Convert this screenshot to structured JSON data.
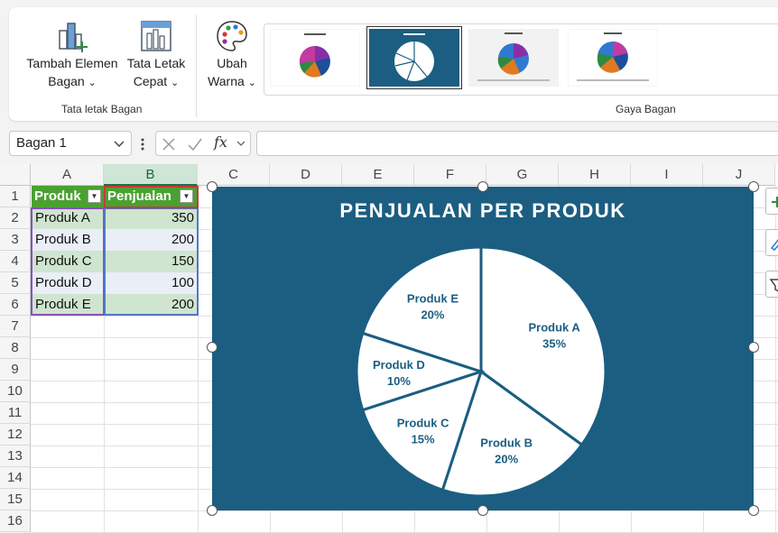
{
  "ribbon": {
    "add_element": {
      "line1": "Tambah Elemen",
      "line2": "Bagan"
    },
    "quick_layout": {
      "line1": "Tata Letak",
      "line2": "Cepat"
    },
    "change_colors": {
      "line1": "Ubah",
      "line2": "Warna"
    },
    "group_layout_label": "Tata letak Bagan",
    "group_styles_label": "Gaya Bagan",
    "chevron": "⌄"
  },
  "formula_bar": {
    "name_box": "Bagan 1",
    "fx_label": "fx",
    "formula": ""
  },
  "sheet": {
    "columns": [
      "A",
      "B",
      "C",
      "D",
      "E",
      "F",
      "G",
      "H",
      "I",
      "J"
    ],
    "rows": [
      "1",
      "2",
      "3",
      "4",
      "5",
      "6",
      "7",
      "8",
      "9",
      "10",
      "11",
      "12",
      "13",
      "14",
      "15",
      "16"
    ],
    "header": {
      "produk": "Produk",
      "penjualan": "Penjualan"
    },
    "data": [
      {
        "produk": "Produk A",
        "penjualan": "350"
      },
      {
        "produk": "Produk B",
        "penjualan": "200"
      },
      {
        "produk": "Produk C",
        "penjualan": "150"
      },
      {
        "produk": "Produk D",
        "penjualan": "100"
      },
      {
        "produk": "Produk E",
        "penjualan": "200"
      }
    ]
  },
  "colors": {
    "chart_bg": "#1b5e81",
    "slice_fill": "#ffffff",
    "slice_stroke": "#1b5e81",
    "label_color": "#1b5e81",
    "header_green": "#4aa130",
    "band_green": "#cfe5cf",
    "band_light": "#e9eef7"
  },
  "chart_data": {
    "type": "pie",
    "title": "PENJUALAN PER PRODUK",
    "categories": [
      "Produk A",
      "Produk B",
      "Produk C",
      "Produk D",
      "Produk E"
    ],
    "values": [
      350,
      200,
      150,
      100,
      200
    ],
    "percent_labels": [
      "35%",
      "20%",
      "15%",
      "10%",
      "20%"
    ],
    "start": "top",
    "direction": "clockwise",
    "legend": "none"
  }
}
